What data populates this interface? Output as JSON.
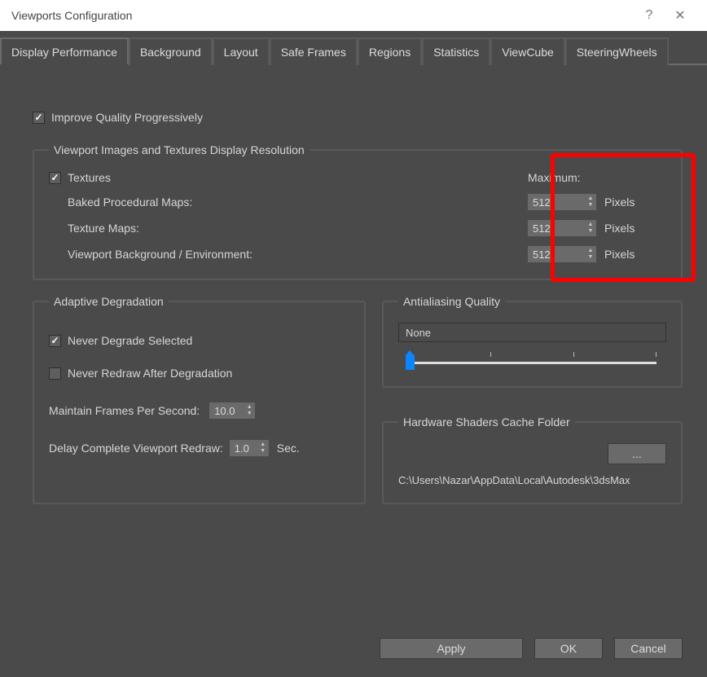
{
  "window": {
    "title": "Viewports Configuration"
  },
  "tabs": {
    "display_performance": "Display Performance",
    "background": "Background",
    "layout": "Layout",
    "safe_frames": "Safe Frames",
    "regions": "Regions",
    "statistics": "Statistics",
    "viewcube": "ViewCube",
    "steering_wheels": "SteeringWheels"
  },
  "improve_quality_label": "Improve Quality Progressively",
  "resolution_group": {
    "legend": "Viewport Images and Textures Display Resolution",
    "textures_label": "Textures",
    "maximum_label": "Maximum:",
    "pixels_label": "Pixels",
    "rows": {
      "baked": {
        "label": "Baked Procedural Maps:",
        "value": "512"
      },
      "texmaps": {
        "label": "Texture Maps:",
        "value": "512"
      },
      "bgenv": {
        "label": "Viewport Background / Environment:",
        "value": "512"
      }
    }
  },
  "adaptive_group": {
    "legend": "Adaptive Degradation",
    "never_degrade": "Never Degrade Selected",
    "never_redraw": "Never Redraw After Degradation",
    "maintain_fps_label": "Maintain Frames Per Second:",
    "maintain_fps_value": "10.0",
    "delay_redraw_label": "Delay Complete Viewport Redraw:",
    "delay_redraw_value": "1.0",
    "sec_label": "Sec."
  },
  "aa_group": {
    "legend": "Antialiasing Quality",
    "value": "None"
  },
  "cache_group": {
    "legend": "Hardware Shaders Cache Folder",
    "browse": "...",
    "path": "C:\\Users\\Nazar\\AppData\\Local\\Autodesk\\3dsMax"
  },
  "buttons": {
    "apply": "Apply",
    "ok": "OK",
    "cancel": "Cancel"
  }
}
